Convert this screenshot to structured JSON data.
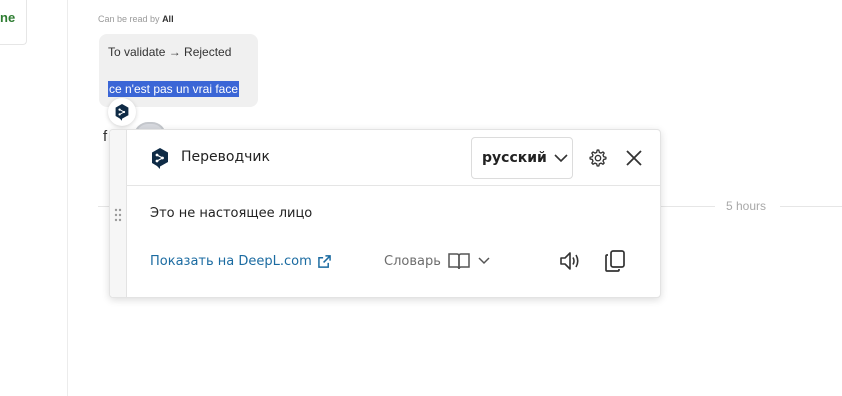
{
  "sidebar": {
    "fragment_text": "ne"
  },
  "message": {
    "read_by_prefix": "Can be read by",
    "read_by_value": "All",
    "status_line": "To validate → Rejected",
    "selected_text": "ce n'est pas un vrai face",
    "time": "5 hours"
  },
  "translator": {
    "title": "Переводчик",
    "language": "русский",
    "translation": "Это не настоящее лицо",
    "open_link": "Показать на DeepL.com",
    "dictionary_label": "Словарь",
    "icons": [
      "deepl-logo",
      "chevron-down",
      "gear",
      "close",
      "external-link",
      "book",
      "speaker",
      "copy"
    ],
    "colors": {
      "link": "#1b6ba1",
      "selection": "#3b66d6",
      "logo": "#0f2b46"
    }
  },
  "peek_glyph": "f"
}
